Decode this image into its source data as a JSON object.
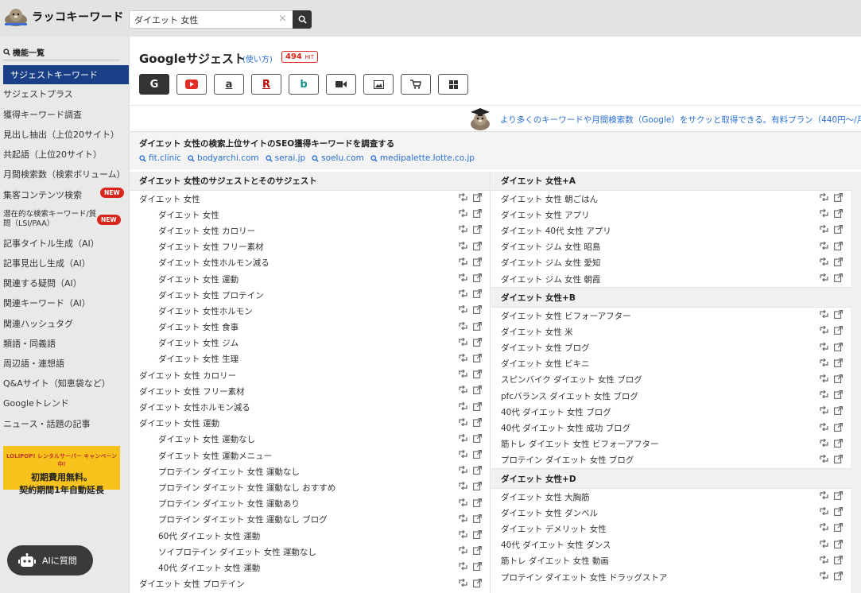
{
  "app": {
    "logo_text": "ラッコキーワード",
    "search_value": "ダイエット 女性"
  },
  "sidebar": {
    "heading": "機能一覧",
    "items": [
      {
        "label": "サジェストキーワード",
        "active": true,
        "new": false
      },
      {
        "label": "サジェストプラス",
        "active": false,
        "new": false
      },
      {
        "label": "獲得キーワード調査",
        "active": false,
        "new": false
      },
      {
        "label": "見出し抽出（上位20サイト）",
        "active": false,
        "new": false
      },
      {
        "label": "共起語（上位20サイト）",
        "active": false,
        "new": false
      },
      {
        "label": "月間検索数（検索ボリューム）",
        "active": false,
        "new": false
      },
      {
        "label": "集客コンテンツ検索",
        "active": false,
        "new": true
      },
      {
        "label": "潜在的な検索キーワード/質問（LSI/PAA）",
        "active": false,
        "new": true
      },
      {
        "label": "記事タイトル生成（AI）",
        "active": false,
        "new": false
      },
      {
        "label": "記事見出し生成（AI）",
        "active": false,
        "new": false
      },
      {
        "label": "関連する疑問（AI）",
        "active": false,
        "new": false
      },
      {
        "label": "関連キーワード（AI）",
        "active": false,
        "new": false
      },
      {
        "label": "関連ハッシュタグ",
        "active": false,
        "new": false
      },
      {
        "label": "類語・同義語",
        "active": false,
        "new": false
      },
      {
        "label": "周辺語・連想語",
        "active": false,
        "new": false
      },
      {
        "label": "Q&Aサイト（知恵袋など）",
        "active": false,
        "new": false
      },
      {
        "label": "Googleトレンド",
        "active": false,
        "new": false
      },
      {
        "label": "ニュース・話題の記事",
        "active": false,
        "new": false
      }
    ],
    "new_badge": "NEW",
    "banner": {
      "top": "LOLIPOP! レンタルサーバー キャンペーン中!",
      "line1": "初期費用無料。",
      "line2": "契約期間1年自動延長"
    },
    "ai_button": "AIに質問"
  },
  "main": {
    "title": "Googleサジェスト",
    "usage_link": "(使い方)",
    "hit_count": "494",
    "hit_suffix": "HIT",
    "engines": [
      "google-icon",
      "youtube-icon",
      "amazon-icon",
      "rakuten-icon",
      "bing-icon",
      "video-icon",
      "image-icon",
      "shopping-icon",
      "apps-icon"
    ],
    "engine_labels": [
      "G",
      "",
      "a",
      "R",
      "b",
      "",
      "",
      "",
      ""
    ],
    "promo": "より多くのキーワードや月間検索数（Google）をサクッと取得できる。有料プラン（440円〜/月",
    "seo_title": "ダイエット 女性の検索上位サイトのSEO獲得キーワードを調査する",
    "seo_sites": [
      "fit.clinic",
      "bodyarchi.com",
      "serai.jp",
      "soelu.com",
      "medipalette.lotte.co.jp"
    ]
  },
  "left_column": {
    "header": "ダイエット 女性のサジェストとそのサジェスト",
    "rows": [
      {
        "kw": "ダイエット 女性",
        "indent": 0
      },
      {
        "kw": "ダイエット 女性",
        "indent": 1
      },
      {
        "kw": "ダイエット 女性 カロリー",
        "indent": 1
      },
      {
        "kw": "ダイエット 女性 フリー素材",
        "indent": 1
      },
      {
        "kw": "ダイエット 女性ホルモン減る",
        "indent": 1
      },
      {
        "kw": "ダイエット 女性 運動",
        "indent": 1
      },
      {
        "kw": "ダイエット 女性 プロテイン",
        "indent": 1
      },
      {
        "kw": "ダイエット 女性ホルモン",
        "indent": 1
      },
      {
        "kw": "ダイエット 女性 食事",
        "indent": 1
      },
      {
        "kw": "ダイエット 女性 ジム",
        "indent": 1
      },
      {
        "kw": "ダイエット 女性 生理",
        "indent": 1
      },
      {
        "kw": "ダイエット 女性 カロリー",
        "indent": 0
      },
      {
        "kw": "ダイエット 女性 フリー素材",
        "indent": 0
      },
      {
        "kw": "ダイエット 女性ホルモン減る",
        "indent": 0
      },
      {
        "kw": "ダイエット 女性 運動",
        "indent": 0
      },
      {
        "kw": "ダイエット 女性 運動なし",
        "indent": 1
      },
      {
        "kw": "ダイエット 女性 運動メニュー",
        "indent": 1
      },
      {
        "kw": "プロテイン ダイエット 女性 運動なし",
        "indent": 1
      },
      {
        "kw": "プロテイン ダイエット 女性 運動なし おすすめ",
        "indent": 1
      },
      {
        "kw": "プロテイン ダイエット 女性 運動あり",
        "indent": 1
      },
      {
        "kw": "プロテイン ダイエット 女性 運動なし ブログ",
        "indent": 1
      },
      {
        "kw": "60代 ダイエット 女性 運動",
        "indent": 1
      },
      {
        "kw": "ソイプロテイン ダイエット 女性 運動なし",
        "indent": 1
      },
      {
        "kw": "40代 ダイエット 女性 運動",
        "indent": 1
      },
      {
        "kw": "ダイエット 女性 プロテイン",
        "indent": 0
      }
    ]
  },
  "right_column": {
    "sections": [
      {
        "header": "ダイエット 女性+A",
        "rows": [
          "ダイエット 女性 朝ごはん",
          "ダイエット 女性 アプリ",
          "ダイエット 40代 女性 アプリ",
          "ダイエット ジム 女性 昭島",
          "ダイエット ジム 女性 愛知",
          "ダイエット ジム 女性 朝霞"
        ]
      },
      {
        "header": "ダイエット 女性+B",
        "rows": [
          "ダイエット 女性 ビフォーアフター",
          "ダイエット 女性 米",
          "ダイエット 女性 ブログ",
          "ダイエット 女性 ビキニ",
          "スピンバイク ダイエット 女性 ブログ",
          "pfcバランス ダイエット 女性 ブログ",
          "40代 ダイエット 女性 ブログ",
          "40代 ダイエット 女性 成功 ブログ",
          "筋トレ ダイエット 女性 ビフォーアフター",
          "プロテイン ダイエット 女性 ブログ"
        ]
      },
      {
        "header": "ダイエット 女性+D",
        "rows": [
          "ダイエット 女性 大胸筋",
          "ダイエット 女性 ダンベル",
          "ダイエット デメリット 女性",
          "40代 ダイエット 女性 ダンス",
          "筋トレ ダイエット 女性 動画",
          "プロテイン ダイエット 女性 ドラッグストア"
        ]
      }
    ]
  }
}
